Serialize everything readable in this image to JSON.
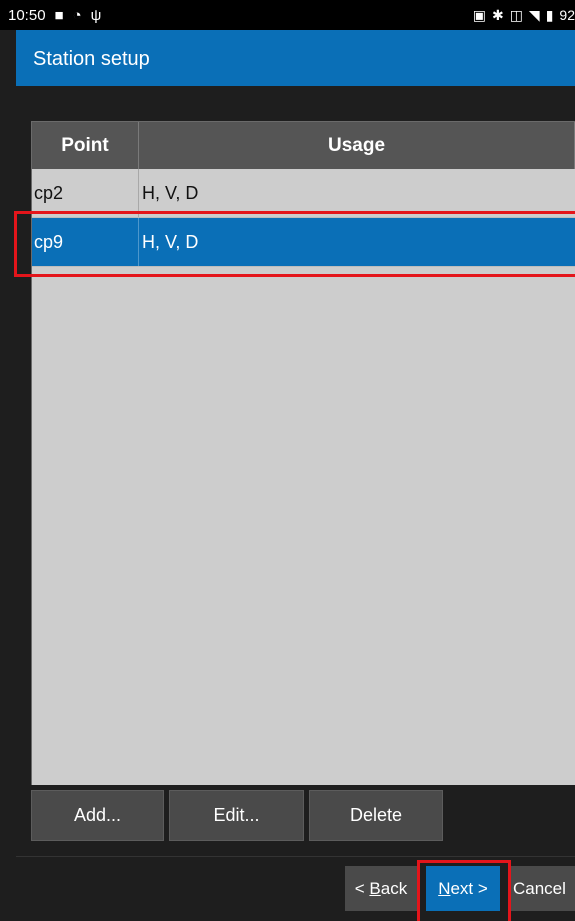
{
  "status_bar": {
    "time": "10:50",
    "battery": "92"
  },
  "header": {
    "title": "Station setup"
  },
  "table": {
    "columns": [
      "Point",
      "Usage"
    ],
    "rows": [
      {
        "point": "cp2",
        "usage": "H, V, D",
        "selected": false
      },
      {
        "point": "cp9",
        "usage": "H, V, D",
        "selected": true
      }
    ]
  },
  "actions": {
    "add": "Add...",
    "edit": "Edit...",
    "delete": "Delete"
  },
  "navigation": {
    "back_prefix": "< ",
    "back_key": "B",
    "back_rest": "ack",
    "next_key": "N",
    "next_rest": "ext >",
    "cancel": "Cancel"
  },
  "colors": {
    "accent": "#0a6fb7",
    "highlight": "#e4151b",
    "table_bg": "#cdcdcd",
    "header_bg": "#555555"
  }
}
